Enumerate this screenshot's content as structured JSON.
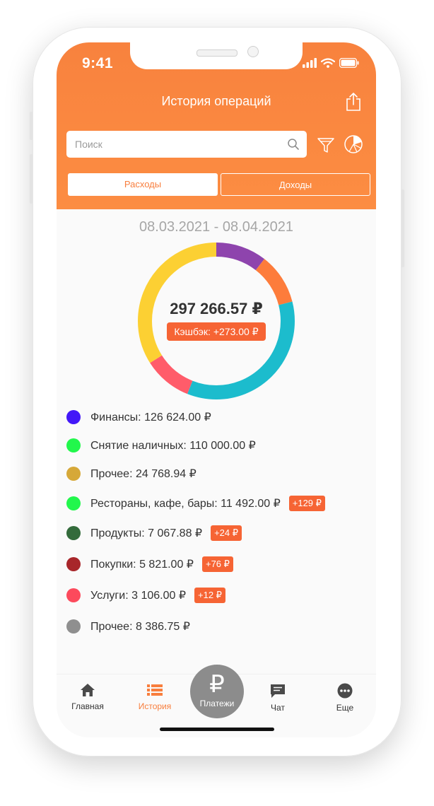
{
  "status_bar": {
    "time": "9:41"
  },
  "header": {
    "title": "История операций",
    "share_icon": "share-icon",
    "search": {
      "placeholder": "Поиск",
      "value": ""
    },
    "filter_icon": "funnel-icon",
    "chart_toggle_icon": "pie-chart-icon"
  },
  "tabs": [
    {
      "label": "Расходы",
      "active": true
    },
    {
      "label": "Доходы",
      "active": false
    }
  ],
  "summary": {
    "date_range": "08.03.2021 - 08.04.2021",
    "total": "297 266.57 ₽",
    "cashback": "Кэшбэк: +273.00 ₽"
  },
  "chart_data": {
    "type": "pie",
    "variant": "donut",
    "values": [
      126624.0,
      110000.0,
      24768.94,
      11492.0,
      7067.88,
      5821.0,
      3106.0,
      8386.75
    ],
    "colors": [
      "#1cbccd",
      "#ff5c6a",
      "#fcd033",
      "#8e44ad",
      "#fd7c3b"
    ],
    "segments_visible": [
      {
        "color": "#8e44ad",
        "share": 0.105
      },
      {
        "color": "#fd7c3b",
        "share": 0.105
      },
      {
        "color": "#1cbccd",
        "share": 0.35
      },
      {
        "color": "#ff5c6a",
        "share": 0.1
      },
      {
        "color": "#fcd033",
        "share": 0.34
      }
    ]
  },
  "legend": [
    {
      "label": "Финансы: 126 624.00 ₽",
      "color": "#4318f8",
      "badge": ""
    },
    {
      "label": "Снятие наличных: 110 000.00 ₽",
      "color": "#22f74c",
      "badge": ""
    },
    {
      "label": "Прочее: 24 768.94 ₽",
      "color": "#d6a838",
      "badge": ""
    },
    {
      "label": "Рестораны, кафе, бары: 11 492.00 ₽",
      "color": "#22f74c",
      "badge": "+129 ₽"
    },
    {
      "label": "Продукты: 7 067.88 ₽",
      "color": "#336b3b",
      "badge": "+24 ₽"
    },
    {
      "label": "Покупки: 5 821.00 ₽",
      "color": "#a8262a",
      "badge": "+76 ₽"
    },
    {
      "label": "Услуги: 3 106.00 ₽",
      "color": "#fc4a5c",
      "badge": "+12 ₽"
    },
    {
      "label": "Прочее: 8 386.75 ₽",
      "color": "#8f8f8f",
      "badge": ""
    }
  ],
  "bottom_nav": {
    "home": {
      "label": "Главная",
      "icon": "home-icon"
    },
    "history": {
      "label": "История",
      "icon": "list-icon"
    },
    "payments": {
      "label": "Платежи",
      "symbol": "₽"
    },
    "chat": {
      "label": "Чат",
      "icon": "chat-icon"
    },
    "more": {
      "label": "Еще",
      "icon": "more-icon"
    }
  },
  "colors": {
    "accent": "#f87e3d",
    "badge": "#f66434"
  }
}
